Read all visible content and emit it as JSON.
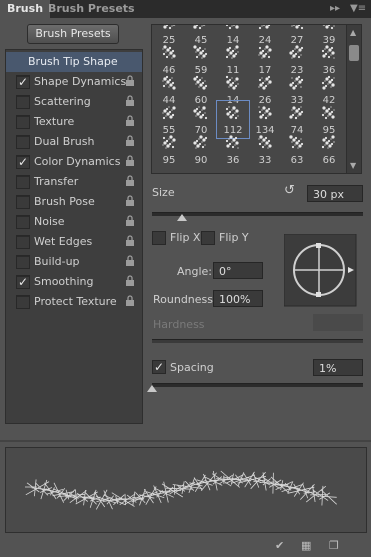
{
  "tabs": [
    {
      "label": "Brush"
    },
    {
      "label": "Brush Presets"
    }
  ],
  "toolbar": {
    "collapse_icon": "double-chevron-icon",
    "menu_icon": "panel-menu-icon"
  },
  "presets_button": "Brush Presets",
  "options": [
    {
      "label": "Brush Tip Shape",
      "checked": null,
      "header": true
    },
    {
      "label": "Shape Dynamics",
      "checked": true
    },
    {
      "label": "Scattering",
      "checked": false
    },
    {
      "label": "Texture",
      "checked": false
    },
    {
      "label": "Dual Brush",
      "checked": false
    },
    {
      "label": "Color Dynamics",
      "checked": true
    },
    {
      "label": "Transfer",
      "checked": false
    },
    {
      "label": "Brush Pose",
      "checked": false
    },
    {
      "label": "Noise",
      "checked": false
    },
    {
      "label": "Wet Edges",
      "checked": false
    },
    {
      "label": "Build-up",
      "checked": false
    },
    {
      "label": "Smoothing",
      "checked": true
    },
    {
      "label": "Protect Texture",
      "checked": false
    }
  ],
  "brush_sizes": [
    [
      "25",
      "45",
      "14",
      "24",
      "27",
      "39"
    ],
    [
      "46",
      "59",
      "11",
      "17",
      "23",
      "36"
    ],
    [
      "44",
      "60",
      "14",
      "26",
      "33",
      "42"
    ],
    [
      "55",
      "70",
      "112",
      "134",
      "74",
      "95"
    ],
    [
      "95",
      "90",
      "36",
      "33",
      "63",
      "66"
    ]
  ],
  "selected_brush": "112",
  "size": {
    "label": "Size",
    "value": "30 px",
    "slider": 0.15
  },
  "flip_x": {
    "label": "Flip X",
    "checked": false
  },
  "flip_y": {
    "label": "Flip Y",
    "checked": false
  },
  "angle": {
    "label": "Angle:",
    "value": "0°"
  },
  "roundness": {
    "label": "Roundness:",
    "value": "100%"
  },
  "hardness": {
    "label": "Hardness",
    "value": ""
  },
  "spacing": {
    "label": "Spacing",
    "checked": true,
    "value": "1%",
    "slider": 0.01
  },
  "colors": {
    "panel": "#535353",
    "tabbar": "#2b2b2b",
    "highlight": "#49586e",
    "field": "#3a3a3a"
  }
}
